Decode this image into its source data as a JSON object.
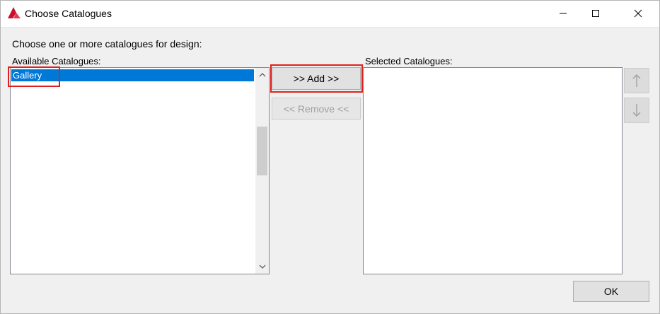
{
  "window": {
    "title": "Choose Catalogues",
    "icon": "app-logo-icon",
    "controls": {
      "minimize": "minimize-icon",
      "maximize": "maximize-icon",
      "close": "close-icon"
    }
  },
  "instruction": "Choose one or more catalogues for design:",
  "available": {
    "label": "Available Catalogues:",
    "items": [
      {
        "label": "Gallery",
        "selected": true
      }
    ]
  },
  "selected": {
    "label": "Selected Catalogues:",
    "items": []
  },
  "buttons": {
    "add": ">> Add >>",
    "remove": "<< Remove <<",
    "ok": "OK",
    "move_up": "arrow-up-icon",
    "move_down": "arrow-down-icon"
  },
  "colors": {
    "selection": "#0078d7",
    "highlight_annotation": "#e02020"
  }
}
